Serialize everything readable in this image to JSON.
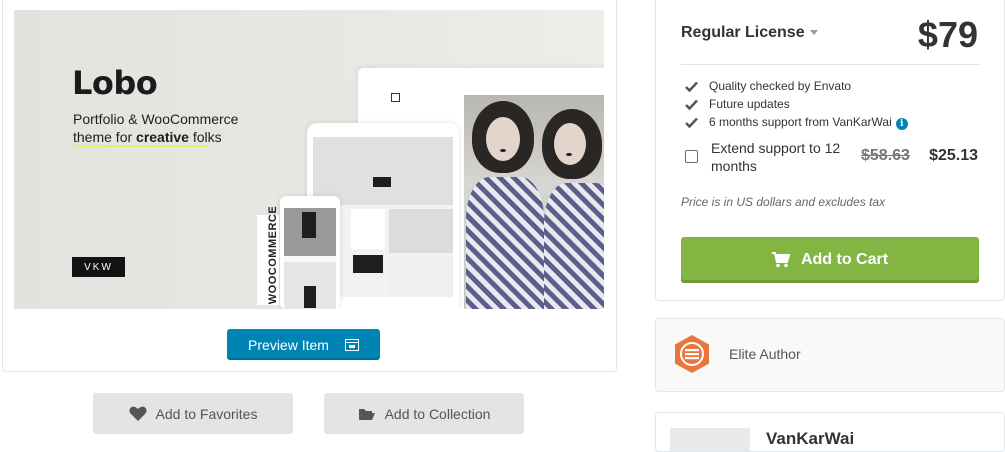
{
  "hero": {
    "title": "Lobo",
    "subtitle_line1": "Portfolio & WooCommerce",
    "subtitle_line2_prefix": "theme for ",
    "subtitle_line2_bold": "creative",
    "subtitle_line2_suffix": " folks",
    "badge": "VKW",
    "woo_label": "WOOCOMMERCE",
    "accent_color": "#e7ef6b"
  },
  "actions": {
    "preview_label": "Preview Item",
    "favorites_label": "Add to Favorites",
    "collection_label": "Add to Collection"
  },
  "purchase": {
    "license_label": "Regular License",
    "price": "$79",
    "features": [
      "Quality checked by Envato",
      "Future updates",
      "6 months support from VanKarWai"
    ],
    "extend_label": "Extend support to 12 months",
    "extend_old_price": "$58.63",
    "extend_new_price": "$25.13",
    "tax_note": "Price is in US dollars and excludes tax",
    "cart_label": "Add to Cart",
    "cart_color": "#82b541"
  },
  "author": {
    "elite_label": "Elite Author",
    "name": "VanKarWai"
  }
}
